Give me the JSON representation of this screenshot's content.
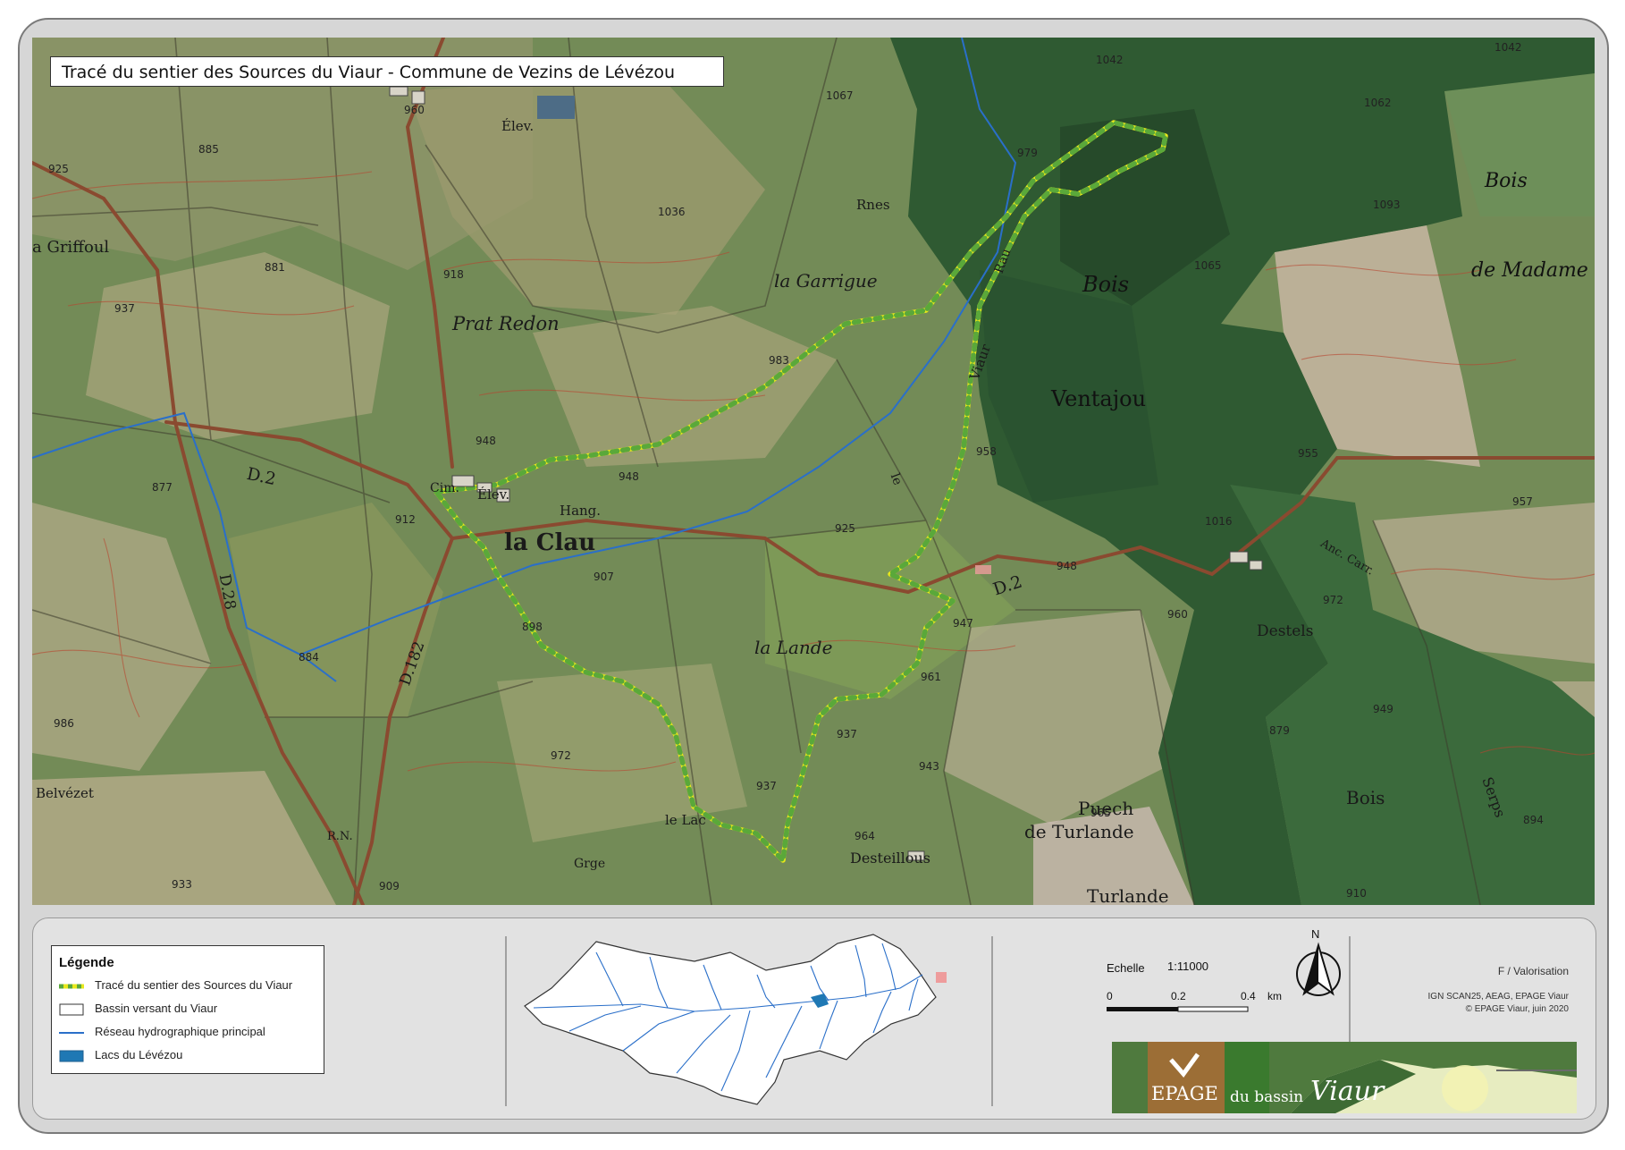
{
  "title": "Tracé du sentier des Sources du Viaur - Commune de Vezins de Lévézou",
  "places": [
    {
      "id": "la-clau",
      "text": "la Clau"
    },
    {
      "id": "prat-redon",
      "text": "Prat Redon"
    },
    {
      "id": "la-garrigue",
      "text": "la Garrigue"
    },
    {
      "id": "bois-ventajou-1",
      "text": "Bois"
    },
    {
      "id": "bois-ventajou-2",
      "text": "Ventajou"
    },
    {
      "id": "bois-madame-1",
      "text": "Bois"
    },
    {
      "id": "bois-madame-2",
      "text": "de Madame"
    },
    {
      "id": "la-lande",
      "text": "la Lande"
    },
    {
      "id": "destels",
      "text": "Destels"
    },
    {
      "id": "puech-1",
      "text": "Puech"
    },
    {
      "id": "puech-2",
      "text": "de Turlande"
    },
    {
      "id": "turlande",
      "text": "Turlande"
    },
    {
      "id": "desteillous",
      "text": "Desteillous"
    },
    {
      "id": "le-lac",
      "text": "le Lac"
    },
    {
      "id": "grge",
      "text": "Grge"
    },
    {
      "id": "belvezet",
      "text": "Belvézet"
    },
    {
      "id": "griffoul",
      "text": "a Griffoul"
    },
    {
      "id": "d2-west",
      "text": "D.2"
    },
    {
      "id": "d2-east",
      "text": "D.2"
    },
    {
      "id": "d28",
      "text": "D.28"
    },
    {
      "id": "d182",
      "text": "D.182"
    },
    {
      "id": "rn",
      "text": "R.N."
    },
    {
      "id": "elev-1",
      "text": "Élev."
    },
    {
      "id": "elev-2",
      "text": "Élev."
    },
    {
      "id": "hang",
      "text": "Hang."
    },
    {
      "id": "cim",
      "text": "Cim."
    },
    {
      "id": "rnes",
      "text": "Rnes"
    },
    {
      "id": "bois-south",
      "text": "Bois"
    },
    {
      "id": "serps",
      "text": "Serps"
    },
    {
      "id": "anc-carr",
      "text": "Anc. Carr."
    },
    {
      "id": "viaur",
      "text": "Viaur"
    },
    {
      "id": "rau",
      "text": "Rau"
    },
    {
      "id": "le",
      "text": "le"
    }
  ],
  "altitudes": [
    "960",
    "925",
    "885",
    "881",
    "937",
    "918",
    "1067",
    "1036",
    "1042",
    "1062",
    "1093",
    "1065",
    "1042",
    "983",
    "948",
    "948",
    "912",
    "907",
    "898",
    "884",
    "877",
    "925",
    "958",
    "955",
    "957",
    "948",
    "947",
    "960",
    "961",
    "937",
    "937",
    "943",
    "964",
    "965",
    "972",
    "986",
    "933",
    "909",
    "1016",
    "979",
    "949",
    "894",
    "910",
    "879",
    "972"
  ],
  "legend": {
    "title": "Légende",
    "items": [
      {
        "label": "Tracé du sentier des Sources du Viaur"
      },
      {
        "label": "Bassin versant du Viaur"
      },
      {
        "label": "Réseau hydrographique principal"
      },
      {
        "label": "Lacs du Lévézou"
      }
    ]
  },
  "scale": {
    "label": "Echelle",
    "ratio": "1:11000",
    "ticks": [
      "0",
      "0.2",
      "0.4"
    ],
    "unit": "km"
  },
  "north": "N",
  "credits": {
    "line1": "F / Valorisation",
    "line2": "IGN SCAN25, AEAG, EPAGE Viaur",
    "line3": "© EPAGE Viaur, juin 2020"
  },
  "logo": {
    "part1": "EPAGE",
    "part2": "du bassin",
    "part3": "Viaur"
  },
  "colors": {
    "trail_yellow": "#e8e81a",
    "trail_green": "#5aa83a",
    "river": "#2a6fc9",
    "lake": "#1f78b4"
  }
}
